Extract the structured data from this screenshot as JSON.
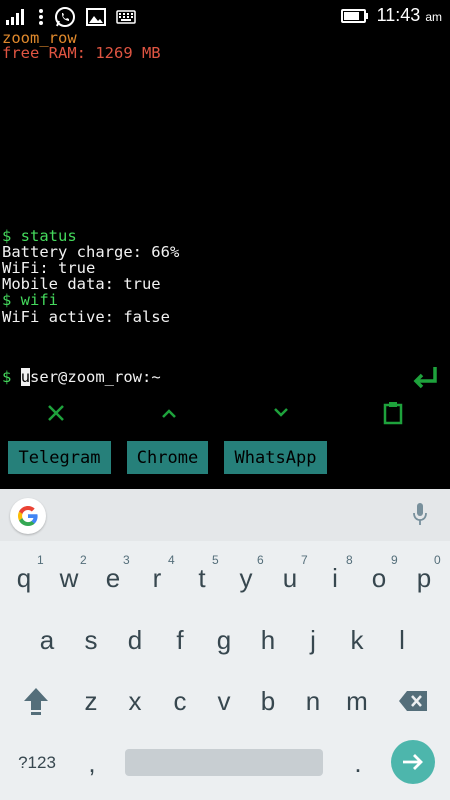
{
  "statusbar": {
    "time": "11:43",
    "ampm": "am"
  },
  "terminal": {
    "lines": [
      {
        "text": "zoom_row",
        "color": "orange"
      },
      {
        "text": "free RAM: 1269 MB",
        "color": "red"
      },
      {
        "text": "$ status",
        "color": "green"
      },
      {
        "text": "Battery charge: 66%",
        "color": "white"
      },
      {
        "text": "WiFi: true",
        "color": "white"
      },
      {
        "text": "Mobile data: true",
        "color": "white"
      },
      {
        "text": "$ wifi",
        "color": "green"
      },
      {
        "text": "WiFi active: false",
        "color": "white"
      }
    ],
    "prompt_symbol": "$",
    "prompt_cursor_char": "u",
    "prompt_rest": "ser@zoom_row:~"
  },
  "extra_keys": [
    {
      "name": "close-icon"
    },
    {
      "name": "chevron-up-icon"
    },
    {
      "name": "chevron-down-icon"
    },
    {
      "name": "clipboard-icon"
    }
  ],
  "shortcuts": [
    "Telegram",
    "Chrome",
    "WhatsApp"
  ],
  "keyboard": {
    "row1": [
      "q",
      "w",
      "e",
      "r",
      "t",
      "y",
      "u",
      "i",
      "o",
      "p"
    ],
    "row1_hints": [
      "1",
      "2",
      "3",
      "4",
      "5",
      "6",
      "7",
      "8",
      "9",
      "0"
    ],
    "row2": [
      "a",
      "s",
      "d",
      "f",
      "g",
      "h",
      "j",
      "k",
      "l"
    ],
    "row3": [
      "z",
      "x",
      "c",
      "v",
      "b",
      "n",
      "m"
    ],
    "symbols_label": "?123",
    "comma": ",",
    "period": "."
  },
  "colors": {
    "accent_green": "#44d85c",
    "shortcut_bg": "#26807a",
    "go_button": "#4db6ac"
  }
}
